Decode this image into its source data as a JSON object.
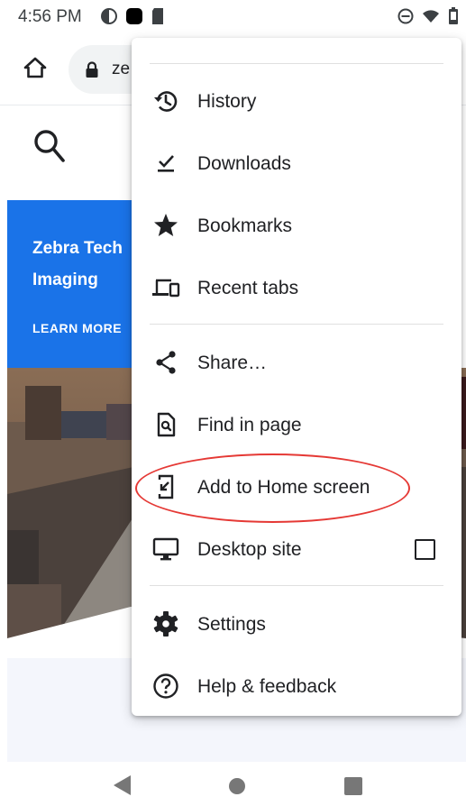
{
  "status_bar": {
    "time": "4:56 PM"
  },
  "toolbar": {
    "url_text": "ze"
  },
  "page": {
    "banner_title": "Zebra Tech\nImaging",
    "banner_link": "LEARN MORE"
  },
  "menu": {
    "items": [
      {
        "label": "History",
        "icon": "history-icon"
      },
      {
        "label": "Downloads",
        "icon": "downloads-icon"
      },
      {
        "label": "Bookmarks",
        "icon": "star-icon"
      },
      {
        "label": "Recent tabs",
        "icon": "devices-icon"
      },
      {
        "label": "Share…",
        "icon": "share-icon"
      },
      {
        "label": "Find in page",
        "icon": "find-in-page-icon"
      },
      {
        "label": "Add to Home screen",
        "icon": "add-to-home-icon"
      },
      {
        "label": "Desktop site",
        "icon": "monitor-icon",
        "checkbox_checked": false
      },
      {
        "label": "Settings",
        "icon": "gear-icon"
      },
      {
        "label": "Help & feedback",
        "icon": "help-icon"
      }
    ]
  },
  "annotation": {
    "highlight": "Add to Home screen",
    "color": "#e53935"
  },
  "colors": {
    "banner": "#1a73e8",
    "annotation": "#e53935"
  }
}
